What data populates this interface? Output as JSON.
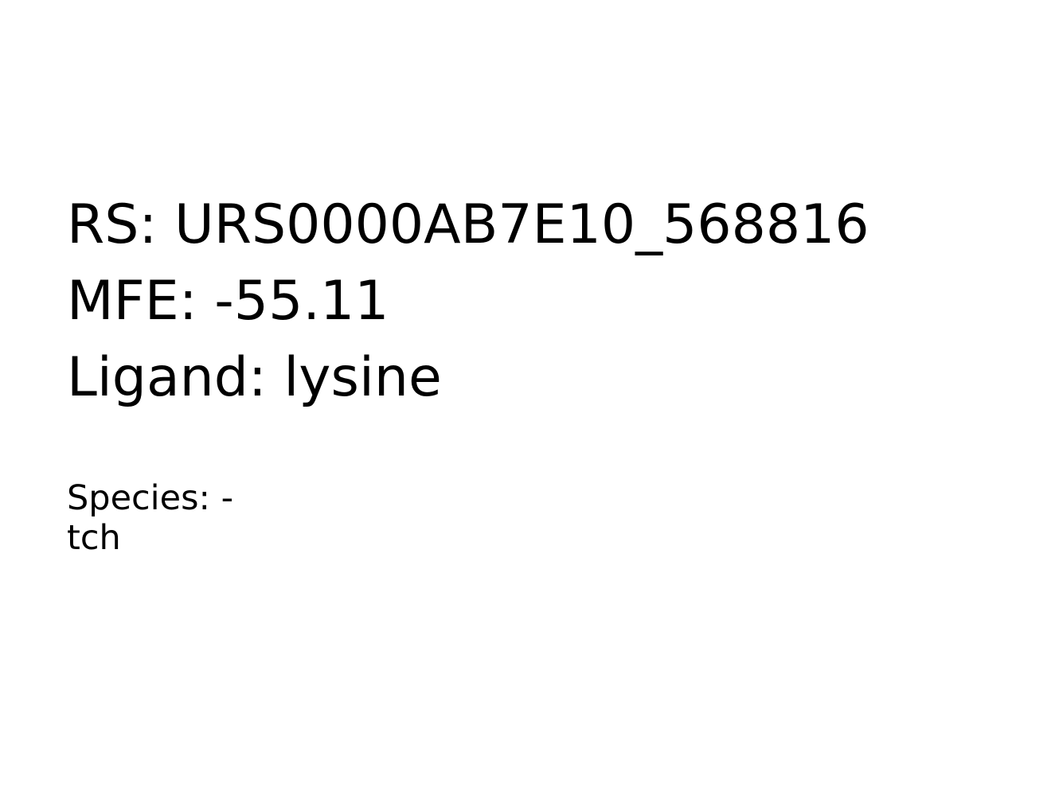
{
  "record": {
    "rs_line": "RS: URS0000AB7E10_568816",
    "mfe_line": "MFE: -55.11",
    "ligand_line": "Ligand: lysine",
    "species_line": "Species: -",
    "species_continuation": "tch"
  }
}
